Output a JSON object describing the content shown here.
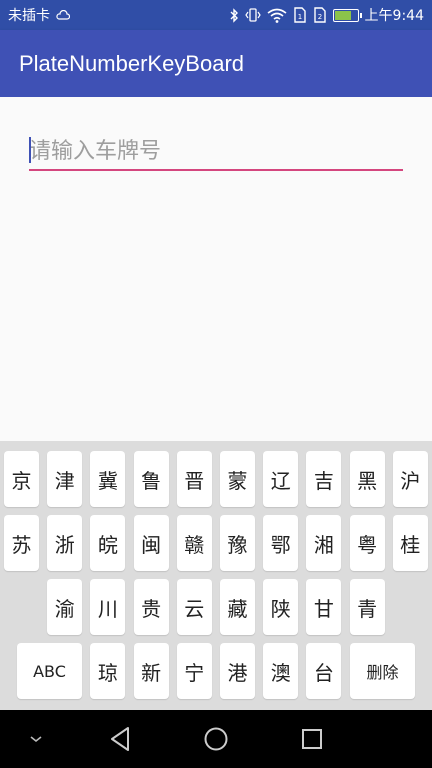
{
  "status_bar": {
    "carrier": "未插卡",
    "time": "上午9:44",
    "battery_level": 0.8,
    "icons": [
      "cloud-icon",
      "bluetooth-icon",
      "vibrate-icon",
      "wifi-icon",
      "sim1-icon",
      "sim2-icon",
      "battery-icon"
    ]
  },
  "app_bar": {
    "title": "PlateNumberKeyBoard"
  },
  "input": {
    "placeholder": "请输入车牌号",
    "value": "",
    "underline_color": "#d4467e"
  },
  "keyboard": {
    "row1": [
      "京",
      "津",
      "冀",
      "鲁",
      "晋",
      "蒙",
      "辽",
      "吉",
      "黑",
      "沪"
    ],
    "row2": [
      "苏",
      "浙",
      "皖",
      "闽",
      "赣",
      "豫",
      "鄂",
      "湘",
      "粤",
      "桂"
    ],
    "row3": [
      "渝",
      "川",
      "贵",
      "云",
      "藏",
      "陕",
      "甘",
      "青"
    ],
    "row4": {
      "left": "ABC",
      "keys": [
        "琼",
        "新",
        "宁",
        "港",
        "澳",
        "台"
      ],
      "right": "删除"
    }
  },
  "nav_bar": {
    "icons": [
      "chevron-down-icon",
      "back-icon",
      "home-icon",
      "recents-icon"
    ]
  },
  "colors": {
    "app_bar": "#3f51b5",
    "status_bar": "#304ea7",
    "accent": "#d4467e",
    "keyboard_bg": "#dcdcdc"
  }
}
